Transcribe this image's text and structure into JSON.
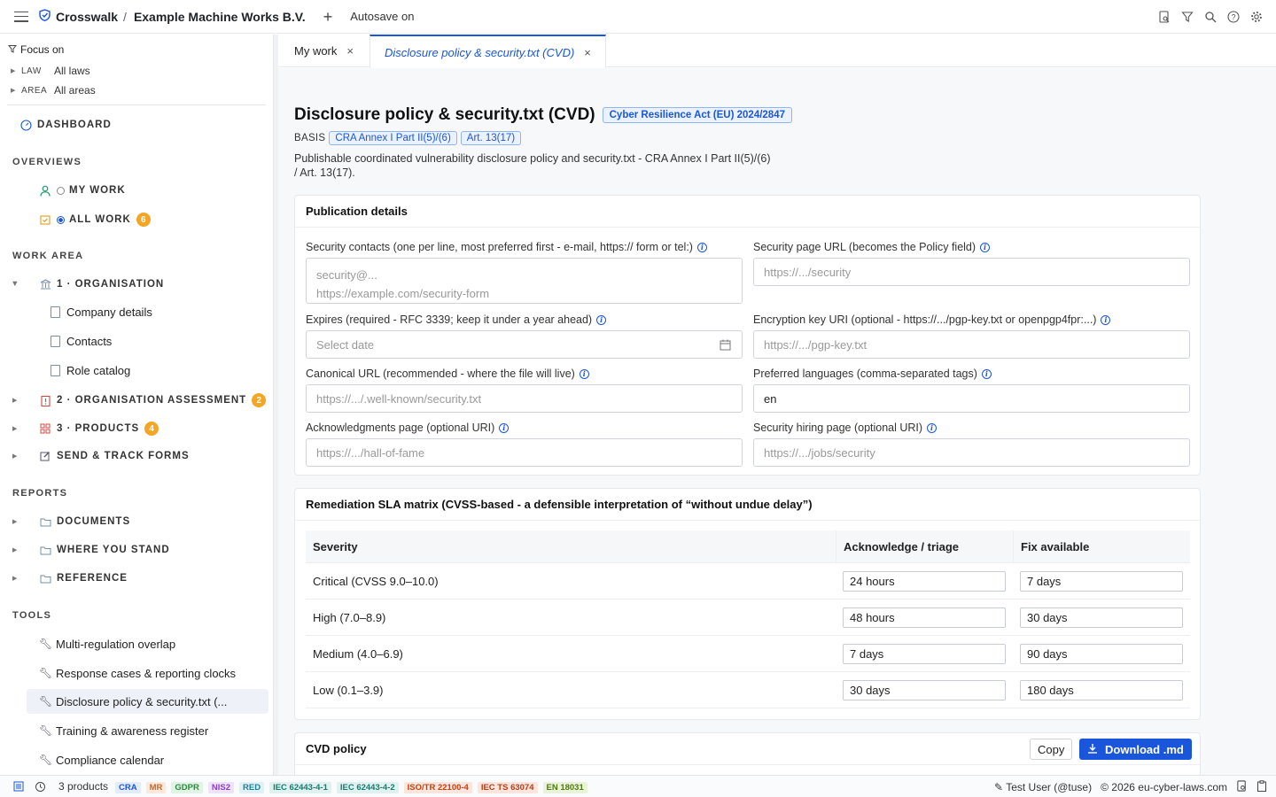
{
  "topbar": {
    "brand": "Crosswalk",
    "separator": "/",
    "company": "Example Machine Works B.V.",
    "add": "+",
    "autosave": "Autosave on",
    "icons": [
      "doc-search-icon",
      "filter-icon",
      "search-icon",
      "help-icon",
      "gear-icon"
    ]
  },
  "sidebar": {
    "focus_label": "Focus on",
    "filters": [
      {
        "key": "LAW",
        "value": "All laws"
      },
      {
        "key": "AREA",
        "value": "All areas"
      }
    ],
    "dashboard": "DASHBOARD",
    "overviews_title": "OVERVIEWS",
    "my_work": "MY WORK",
    "all_work": "ALL WORK",
    "all_work_count": "6",
    "work_area_title": "WORK AREA",
    "organisation": "1 · ORGANISATION",
    "org_children": [
      "Company details",
      "Contacts",
      "Role catalog"
    ],
    "org_assessment": "2 · ORGANISATION ASSESSMENT",
    "org_assessment_count": "2",
    "products": "3 · PRODUCTS",
    "products_count": "4",
    "send_track": "SEND & TRACK FORMS",
    "reports_title": "REPORTS",
    "documents": "DOCUMENTS",
    "where_you_stand": "WHERE YOU STAND",
    "reference": "REFERENCE",
    "tools_title": "TOOLS",
    "tools": [
      "Multi-regulation overlap",
      "Response cases & reporting clocks",
      "Disclosure policy & security.txt (...",
      "Training & awareness register",
      "Compliance calendar"
    ]
  },
  "tabs": [
    {
      "label": "My work",
      "close": "×"
    },
    {
      "label": "Disclosure policy & security.txt (CVD)",
      "close": "×"
    }
  ],
  "page": {
    "title": "Disclosure policy & security.txt (CVD)",
    "law_tag": "Cyber Resilience Act (EU) 2024/2847",
    "basis_label": "BASIS",
    "basis_tags": [
      "CRA Annex I Part II(5)/(6)",
      "Art. 13(17)"
    ],
    "description": "Publishable coordinated vulnerability disclosure policy and security.txt - CRA Annex I Part II(5)/(6) / Art. 13(17)."
  },
  "publication": {
    "title": "Publication details",
    "contacts_label": "Security contacts (one per line, most preferred first - e-mail, https:// form or tel:)",
    "contacts_placeholder_1": "security@...",
    "contacts_placeholder_2": "https://example.com/security-form",
    "security_page_label": "Security page URL (becomes the Policy field)",
    "security_page_placeholder": "https://.../security",
    "expires_label": "Expires (required - RFC 3339; keep it under a year ahead)",
    "expires_placeholder": "Select date",
    "encryption_label": "Encryption key URI (optional - https://.../pgp-key.txt or openpgp4fpr:...)",
    "encryption_placeholder": "https://.../pgp-key.txt",
    "canonical_label": "Canonical URL (recommended - where the file will live)",
    "canonical_placeholder": "https://.../.well-known/security.txt",
    "languages_label": "Preferred languages (comma-separated tags)",
    "languages_value": "en",
    "ack_label": "Acknowledgments page (optional URI)",
    "ack_placeholder": "https://.../hall-of-fame",
    "hiring_label": "Security hiring page (optional URI)",
    "hiring_placeholder": "https://.../jobs/security"
  },
  "sla": {
    "title": "Remediation SLA matrix (CVSS-based - a defensible interpretation of “without undue delay”)",
    "headers": [
      "Severity",
      "Acknowledge / triage",
      "Fix available"
    ],
    "rows": [
      {
        "severity": "Critical (CVSS 9.0–10.0)",
        "ack": "24 hours",
        "fix": "7 days"
      },
      {
        "severity": "High (7.0–8.9)",
        "ack": "48 hours",
        "fix": "30 days"
      },
      {
        "severity": "Medium (4.0–6.9)",
        "ack": "7 days",
        "fix": "90 days"
      },
      {
        "severity": "Low (0.1–3.9)",
        "ack": "30 days",
        "fix": "180 days"
      }
    ]
  },
  "cvd": {
    "title": "CVD policy",
    "copy": "Copy",
    "download": "Download .md"
  },
  "statusbar": {
    "products": "3 products",
    "chips": [
      {
        "label": "CRA",
        "bg": "#e3ecfb",
        "fg": "#1a56db"
      },
      {
        "label": "MR",
        "bg": "#fde9dc",
        "fg": "#d2641b"
      },
      {
        "label": "GDPR",
        "bg": "#e1f3e4",
        "fg": "#2a8a3e"
      },
      {
        "label": "NIS2",
        "bg": "#efe3fb",
        "fg": "#8a3fc9"
      },
      {
        "label": "RED",
        "bg": "#e0f1f6",
        "fg": "#1e7f9a"
      },
      {
        "label": "IEC 62443-4-1",
        "bg": "#dff2f0",
        "fg": "#197a70"
      },
      {
        "label": "IEC 62443-4-2",
        "bg": "#dff2f0",
        "fg": "#197a70"
      },
      {
        "label": "ISO/TR 22100-4",
        "bg": "#fde4dc",
        "fg": "#c2410c"
      },
      {
        "label": "IEC TS 63074",
        "bg": "#fde4dc",
        "fg": "#b3401a"
      },
      {
        "label": "EN 18031",
        "bg": "#eaf3d8",
        "fg": "#4d7a12"
      }
    ],
    "user": "Test User (@tuse)",
    "copyright": "© 2026 eu-cyber-laws.com"
  }
}
